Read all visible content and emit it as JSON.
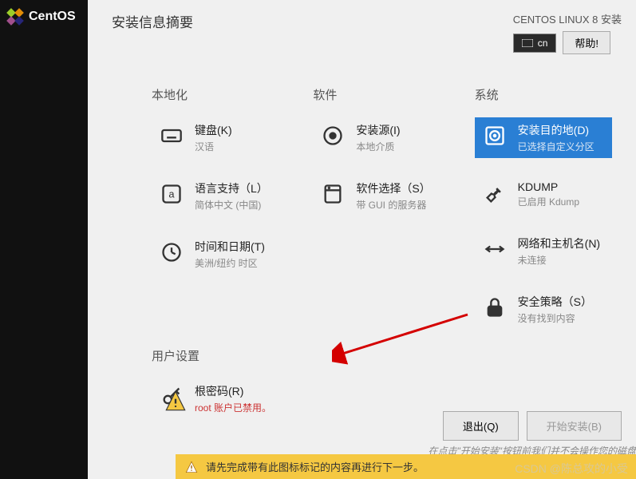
{
  "logo_text": "CentOS",
  "page_title": "安装信息摘要",
  "installer_title": "CENTOS LINUX 8 安装",
  "lang_indicator": "cn",
  "help_label": "帮助!",
  "sections": {
    "localization": "本地化",
    "software": "软件",
    "system": "系统",
    "user": "用户设置"
  },
  "items": {
    "keyboard": {
      "label": "键盘(K)",
      "sub": "汉语"
    },
    "language": {
      "label": "语言支持（L）",
      "sub": "简体中文 (中国)"
    },
    "datetime": {
      "label": "时间和日期(T)",
      "sub": "美洲/纽约 时区"
    },
    "source": {
      "label": "安装源(I)",
      "sub": "本地介质"
    },
    "selection": {
      "label": "软件选择（S）",
      "sub": "带 GUI 的服务器"
    },
    "destination": {
      "label": "安装目的地(D)",
      "sub": "已选择自定义分区"
    },
    "kdump": {
      "label": "KDUMP",
      "sub": "已启用 Kdump"
    },
    "network": {
      "label": "网络和主机名(N)",
      "sub": "未连接"
    },
    "security": {
      "label": "安全策略（S）",
      "sub": "没有找到内容"
    },
    "rootpw": {
      "label": "根密码(R)",
      "sub": "root 账户已禁用。"
    }
  },
  "footer": {
    "quit": "退出(Q)",
    "begin": "开始安装(B)",
    "hint": "在点击\"开始安装\"按钮前我们并不会操作您的磁盘"
  },
  "warning_text": "请先完成带有此图标标记的内容再进行下一步。",
  "watermark": "CSDN @陈总攻的小受"
}
